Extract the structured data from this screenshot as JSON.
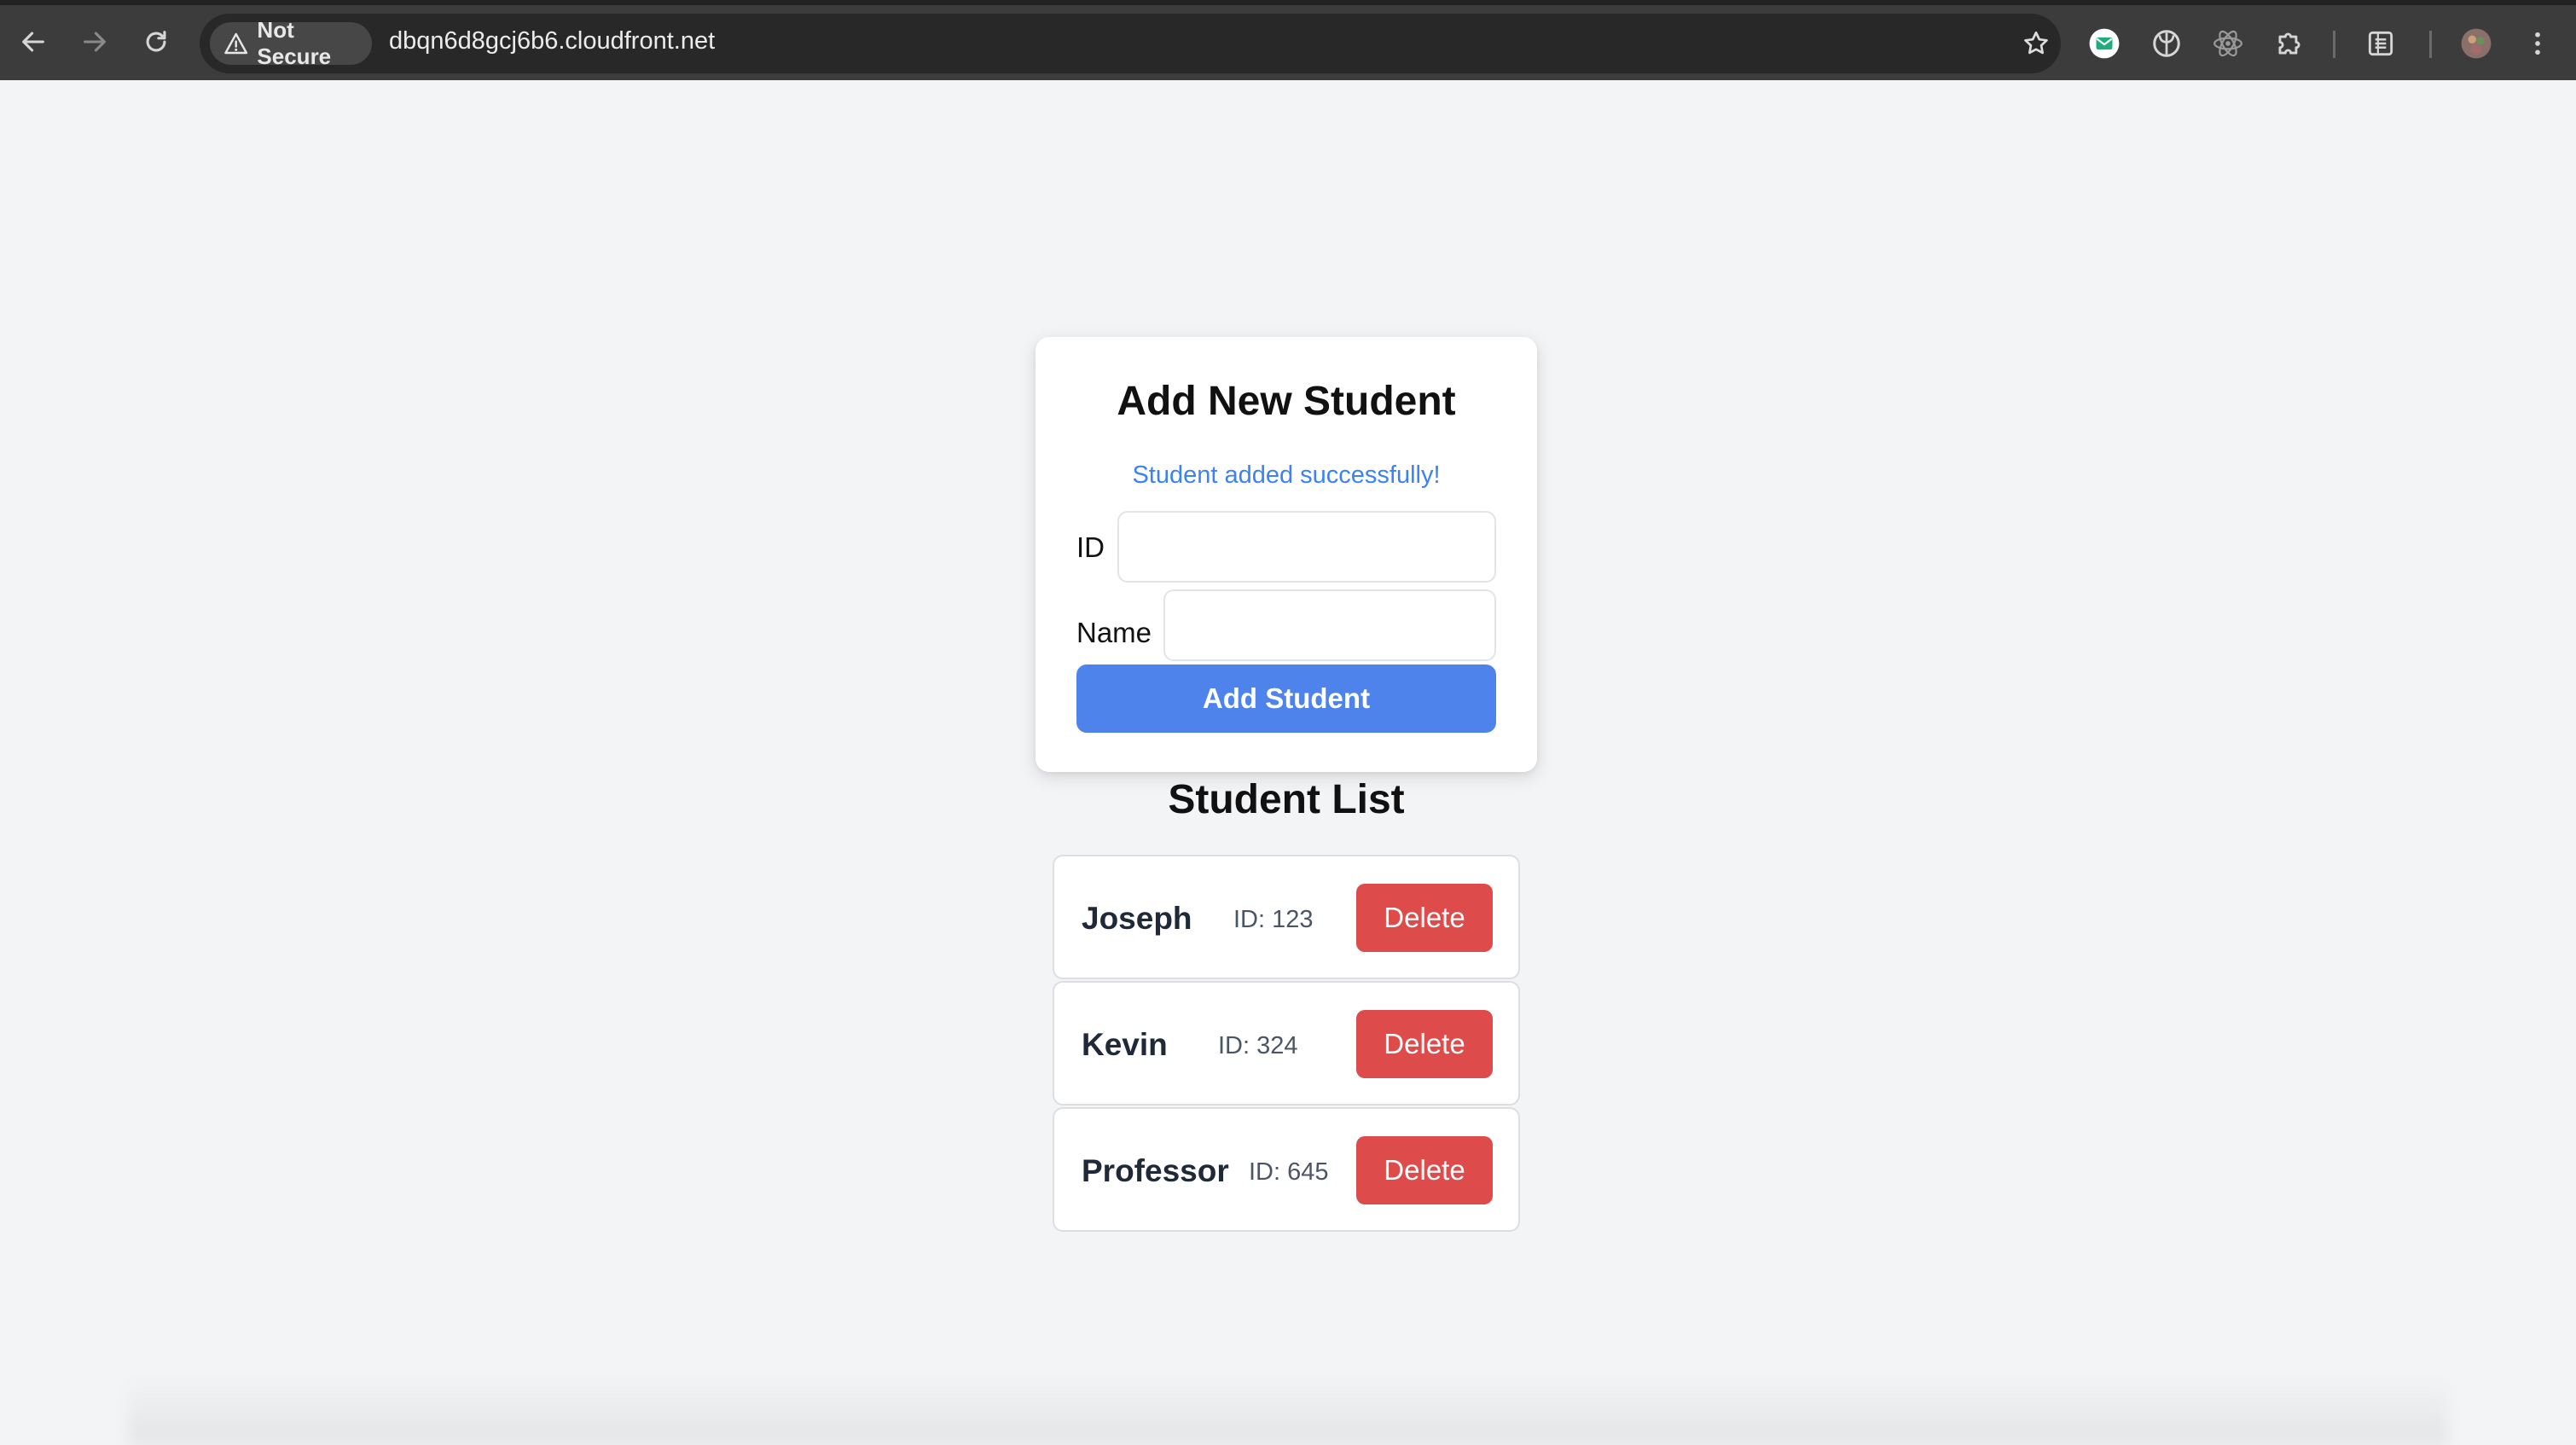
{
  "browser": {
    "security_label": "Not Secure",
    "url": "dbqn6d8gcj6b6.cloudfront.net",
    "icons": [
      "back-icon",
      "forward-icon",
      "reload-icon",
      "warning-icon",
      "bookmark-star-icon",
      "extension-mail-icon",
      "extension-leaf-icon",
      "react-devtools-icon",
      "extensions-puzzle-icon",
      "reading-list-icon",
      "profile-avatar",
      "more-menu-icon"
    ]
  },
  "form": {
    "title": "Add New Student",
    "status_message": "Student added successfully!",
    "id_label": "ID",
    "id_value": "",
    "name_label": "Name",
    "name_value": "",
    "submit_label": "Add Student"
  },
  "list": {
    "title": "Student List",
    "students": [
      {
        "name": "Joseph",
        "id_text": "ID: 123",
        "delete_label": "Delete"
      },
      {
        "name": "Kevin",
        "id_text": "ID: 324",
        "delete_label": "Delete"
      },
      {
        "name": "Professor",
        "id_text": "ID: 645",
        "delete_label": "Delete"
      }
    ]
  },
  "colors": {
    "primary": "#4f83ec",
    "success_text": "#3b82f6",
    "danger": "#de4b4b",
    "page_bg": "#f3f4f6",
    "chrome_bg": "#3c3c3c"
  }
}
